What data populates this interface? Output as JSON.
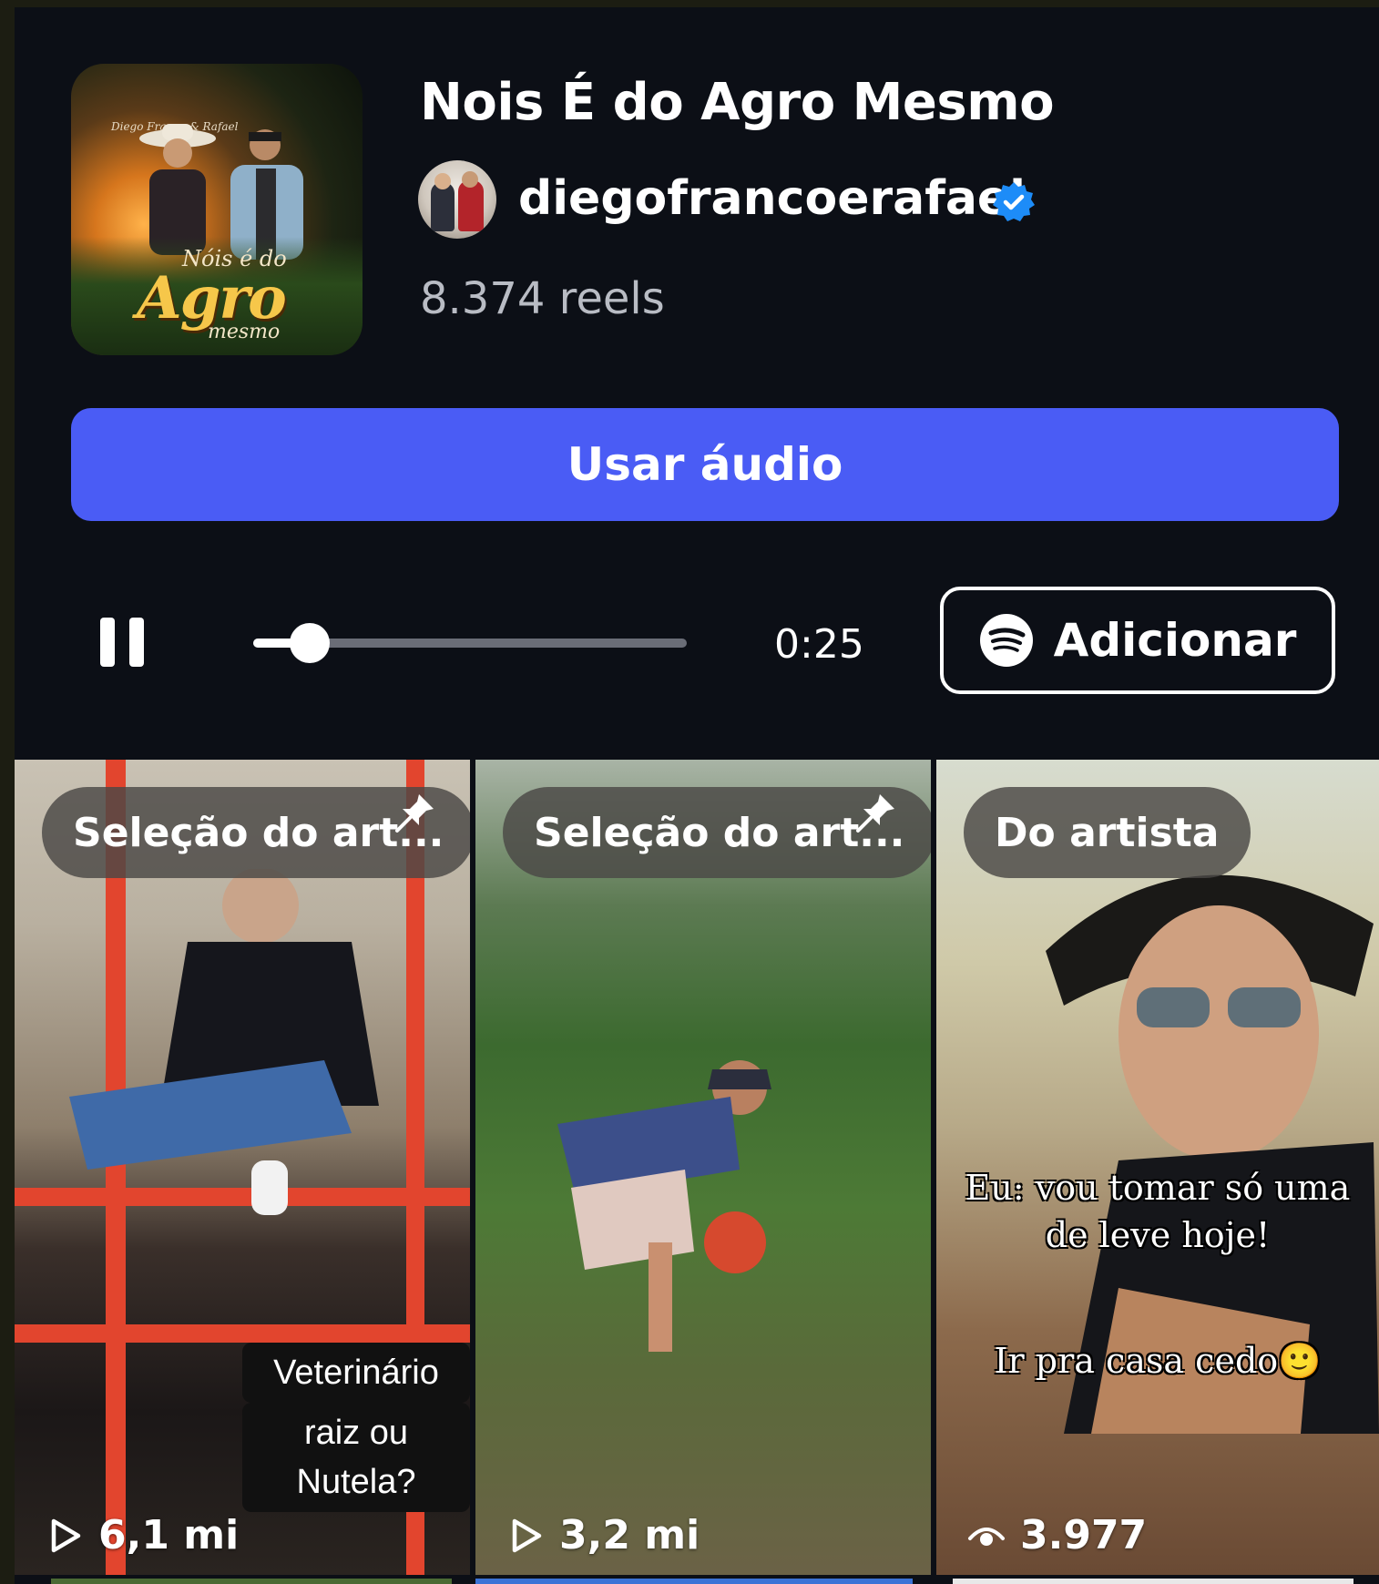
{
  "audio": {
    "title": "Nois É do Agro Mesmo",
    "artist": "diegofrancoerafael",
    "reels_count": "8.374 reels",
    "cover": {
      "band_text": "Diego Franco & Rafael",
      "line1": "Nóis é do",
      "line2": "Agro",
      "line3": "mesmo"
    }
  },
  "actions": {
    "use_audio": "Usar áudio",
    "add_label": "Adicionar"
  },
  "player": {
    "time": "0:25",
    "progress": 0.13
  },
  "reels": [
    {
      "badge": "Seleção do art...",
      "pinned": true,
      "caption_lines": [
        "Veterinário",
        "raiz ou Nutela?"
      ],
      "count": "6,1 mi",
      "count_icon": "play-icon"
    },
    {
      "badge": "Seleção do art...",
      "pinned": true,
      "caption_lines": [],
      "count": "3,2 mi",
      "count_icon": "play-icon"
    },
    {
      "badge": "Do artista",
      "pinned": false,
      "caption_lines": [
        "Eu: vou tomar só uma",
        "de leve hoje!",
        "Ir pra casa cedo🙂"
      ],
      "count": "3.977",
      "count_icon": "eye-icon"
    }
  ],
  "colors": {
    "background": "#0c0f16",
    "accent": "#4a5cf5",
    "verified": "#1d8cf8"
  }
}
